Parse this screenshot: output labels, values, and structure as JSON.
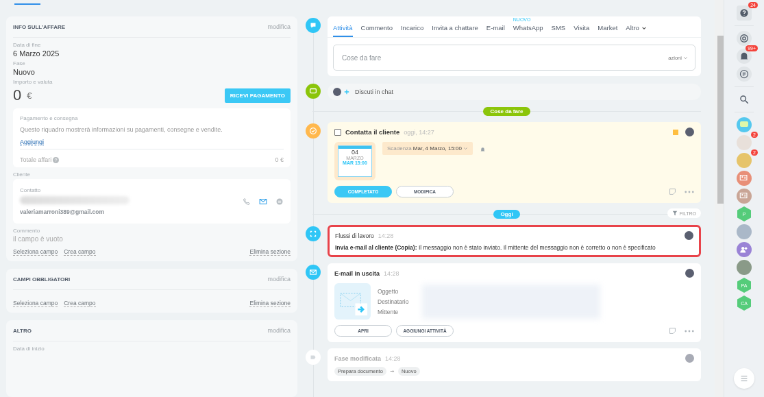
{
  "deal_info": {
    "title": "INFO SULL'AFFARE",
    "edit": "modifica",
    "fields": [
      {
        "label": "Data di fine",
        "value": "6 Marzo 2025"
      },
      {
        "label": "Fase",
        "value": "Nuovo"
      }
    ],
    "amount_label": "Importo e valuta",
    "amount": "0",
    "currency": "€",
    "pay_button": "RICEVI PAGAMENTO",
    "payment": {
      "title": "Pagamento e consegna",
      "text": "Questo riquadro mostrerà informazioni su pagamenti, consegne e vendite.",
      "link": "Aggiungi",
      "total_label": "Totale affari",
      "total": "0 €"
    },
    "client_label": "Cliente",
    "contact_label": "Contatto",
    "contact_email": "valeriamarroni389@gmail.com",
    "comment_label": "Commento",
    "comment_value": "il campo è vuoto",
    "links": [
      "Seleziona campo",
      "Crea campo"
    ],
    "delete": "Elimina sezione"
  },
  "required": {
    "title": "CAMPI OBBLIGATORI",
    "edit": "modifica",
    "links": [
      "Seleziona campo",
      "Crea campo"
    ],
    "delete": "Elimina sezione"
  },
  "other": {
    "title": "ALTRO",
    "edit": "modifica",
    "field_label": "Data di inizio"
  },
  "composer": {
    "tabs": [
      {
        "label": "Attività",
        "selected": true
      },
      {
        "label": "Commento",
        "selected": false
      },
      {
        "label": "Incarico",
        "selected": false
      },
      {
        "label": "Invita a chattare",
        "selected": false
      },
      {
        "label": "E-mail",
        "selected": false
      },
      {
        "label": "WhatsApp",
        "selected": false,
        "badge": "NUOVO"
      },
      {
        "label": "SMS",
        "selected": false
      },
      {
        "label": "Visita",
        "selected": false
      },
      {
        "label": "Market",
        "selected": false
      },
      {
        "label": "Altro",
        "selected": false,
        "dropdown": true
      }
    ],
    "placeholder": "Cose da fare",
    "actions": "azioni"
  },
  "chat": {
    "label": "Discuti in chat"
  },
  "todo_divider": "Cose da fare",
  "task": {
    "checked": false,
    "title": "Contatta il cliente",
    "time": "oggi, 14:27",
    "calendar_day": "04",
    "calendar_month": "MARZO",
    "calendar_sub": "MAR 15:00",
    "deadline_label": "Scadenza",
    "deadline": "Mar, 4 Marzo, 15:00",
    "buttons": [
      "COMPLETATO",
      "MODIFICA"
    ]
  },
  "today_divider": "Oggi",
  "filter": "FILTRO",
  "workflow": {
    "title": "Flussi di lavoro",
    "time": "14:28",
    "message": "**Invia e-mail al cliente (Copia):** Il messaggio non è stato inviato. Il mittente del messaggio non è corretto o non è specificato",
    "highlighted": true
  },
  "email": {
    "title": "E-mail in uscita",
    "time": "14:28",
    "fields": [
      "Oggetto",
      "Destinatario",
      "Mittente"
    ],
    "buttons": [
      "APRI",
      "AGGIUNGI ATTIVITÀ"
    ]
  },
  "stage": {
    "title": "Fase modificata",
    "time": "14:28",
    "from": "Prepara documento",
    "to": "Nuovo"
  },
  "sidebar": [
    {
      "kind": "help",
      "badge": "24"
    },
    {
      "kind": "divider"
    },
    {
      "kind": "target"
    },
    {
      "kind": "bell",
      "badge": "99+"
    },
    {
      "kind": "list"
    },
    {
      "kind": "divider"
    },
    {
      "kind": "search"
    },
    {
      "kind": "divider"
    },
    {
      "kind": "chat",
      "color": "#55c8ee"
    },
    {
      "kind": "avatar",
      "color": "#e8e0da",
      "badge": "2"
    },
    {
      "kind": "avatar",
      "color": "#e6c46a",
      "badge": "2"
    },
    {
      "kind": "card",
      "color": "#e88f78"
    },
    {
      "kind": "card",
      "color": "#c9a596"
    },
    {
      "kind": "hex",
      "color": "#55cc7a",
      "text": "P"
    },
    {
      "kind": "avatar",
      "color": "#aab8c8"
    },
    {
      "kind": "group",
      "color": "#9a83d6"
    },
    {
      "kind": "avatar",
      "color": "#8a9a88"
    },
    {
      "kind": "hex",
      "color": "#55cc7a",
      "text": "PA"
    },
    {
      "kind": "hex",
      "color": "#55cc7a",
      "text": "CA"
    }
  ]
}
